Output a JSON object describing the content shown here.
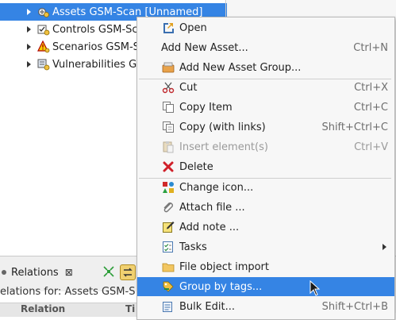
{
  "tree": {
    "items": [
      {
        "label": "Assets GSM-Scan [Unnamed]",
        "icon": "assets-icon"
      },
      {
        "label": "Controls GSM-Sc",
        "icon": "controls-icon"
      },
      {
        "label": "Scenarios GSM-S",
        "icon": "scenarios-icon"
      },
      {
        "label": "Vulnerabilities G",
        "icon": "vulnerabilities-icon"
      }
    ]
  },
  "menu": {
    "items": [
      {
        "label": "Open",
        "shortcut": "",
        "icon": "open-icon"
      },
      {
        "label": "Add New Asset...",
        "shortcut": "Ctrl+N",
        "icon": ""
      },
      {
        "label": "Add New Asset Group...",
        "shortcut": "",
        "icon": "asset-group-icon"
      },
      {
        "label": "Cut",
        "shortcut": "Ctrl+X",
        "icon": "scissors-icon"
      },
      {
        "label": "Copy Item",
        "shortcut": "Ctrl+C",
        "icon": "copy-icon"
      },
      {
        "label": "Copy (with links)",
        "shortcut": "Shift+Ctrl+C",
        "icon": "copy-links-icon"
      },
      {
        "label": "Insert element(s)",
        "shortcut": "Ctrl+V",
        "icon": "paste-icon"
      },
      {
        "label": "Delete",
        "shortcut": "",
        "icon": "delete-icon"
      },
      {
        "label": "Change icon...",
        "shortcut": "",
        "icon": "change-icon-icon"
      },
      {
        "label": "Attach file ...",
        "shortcut": "",
        "icon": "paperclip-icon"
      },
      {
        "label": "Add note ...",
        "shortcut": "",
        "icon": "note-icon"
      },
      {
        "label": "Tasks",
        "shortcut": "",
        "icon": "tasks-icon"
      },
      {
        "label": "File object import",
        "shortcut": "",
        "icon": "folder-icon"
      },
      {
        "label": "Group by tags...",
        "shortcut": "",
        "icon": "group-tags-icon"
      },
      {
        "label": "Bulk Edit...",
        "shortcut": "Shift+Ctrl+B",
        "icon": "bulk-edit-icon"
      }
    ]
  },
  "relations": {
    "tab_label": "Relations",
    "close_glyph": "⊠",
    "for_text": "elations for: Assets GSM-S",
    "column_header": "Relation",
    "second_header": "Ti"
  },
  "colors": {
    "selection": "#3584e4",
    "menu_bg": "#f7f7f7"
  }
}
